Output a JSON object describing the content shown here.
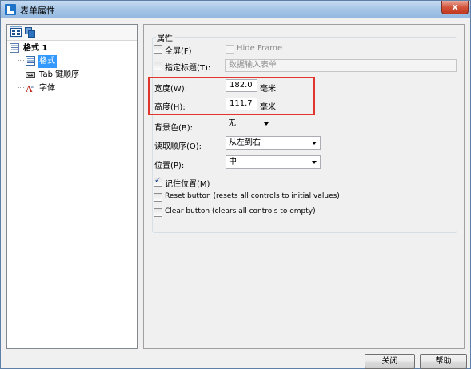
{
  "window": {
    "title": "表单属性",
    "close_label": "x"
  },
  "left_panel": {
    "tree": {
      "root_label": "格式 1",
      "items": [
        {
          "label": "格式",
          "icon": "format-icon",
          "selected": true
        },
        {
          "label": "Tab 键顺序",
          "icon": "tab-order-icon",
          "selected": false
        },
        {
          "label": "字体",
          "icon": "font-icon",
          "selected": false
        }
      ]
    },
    "toolbar": {
      "icons": [
        "expand-tree-icon",
        "copy-icon"
      ]
    }
  },
  "properties": {
    "group_label": "属性",
    "fullscreen": {
      "label": "全屏(F)",
      "checked": false
    },
    "hide_frame": {
      "label": "Hide Frame",
      "checked": false,
      "disabled": true
    },
    "title_check": {
      "label": "指定标题(T):",
      "checked": false
    },
    "title_input": {
      "placeholder": "数据输入表单"
    },
    "width": {
      "label": "宽度(W):",
      "value": "182.0",
      "unit": "毫米"
    },
    "height": {
      "label": "高度(H):",
      "value": "111.7",
      "unit": "毫米"
    },
    "background": {
      "label": "背景色(B):",
      "value": "无"
    },
    "reading_order": {
      "label": "读取顺序(O):",
      "value": "从左到右"
    },
    "position": {
      "label": "位置(P):",
      "value": "中"
    },
    "remember_position": {
      "label": "记住位置(M)",
      "checked": true
    },
    "reset_button": {
      "label": "Reset button (resets all controls to initial values)",
      "checked": false
    },
    "clear_button": {
      "label": "Clear button (clears all controls to empty)",
      "checked": false
    }
  },
  "footer": {
    "close_label": "关闭",
    "help_label": "帮助"
  },
  "colors": {
    "selection": "#3399ff",
    "highlight_border": "#e0362d"
  }
}
